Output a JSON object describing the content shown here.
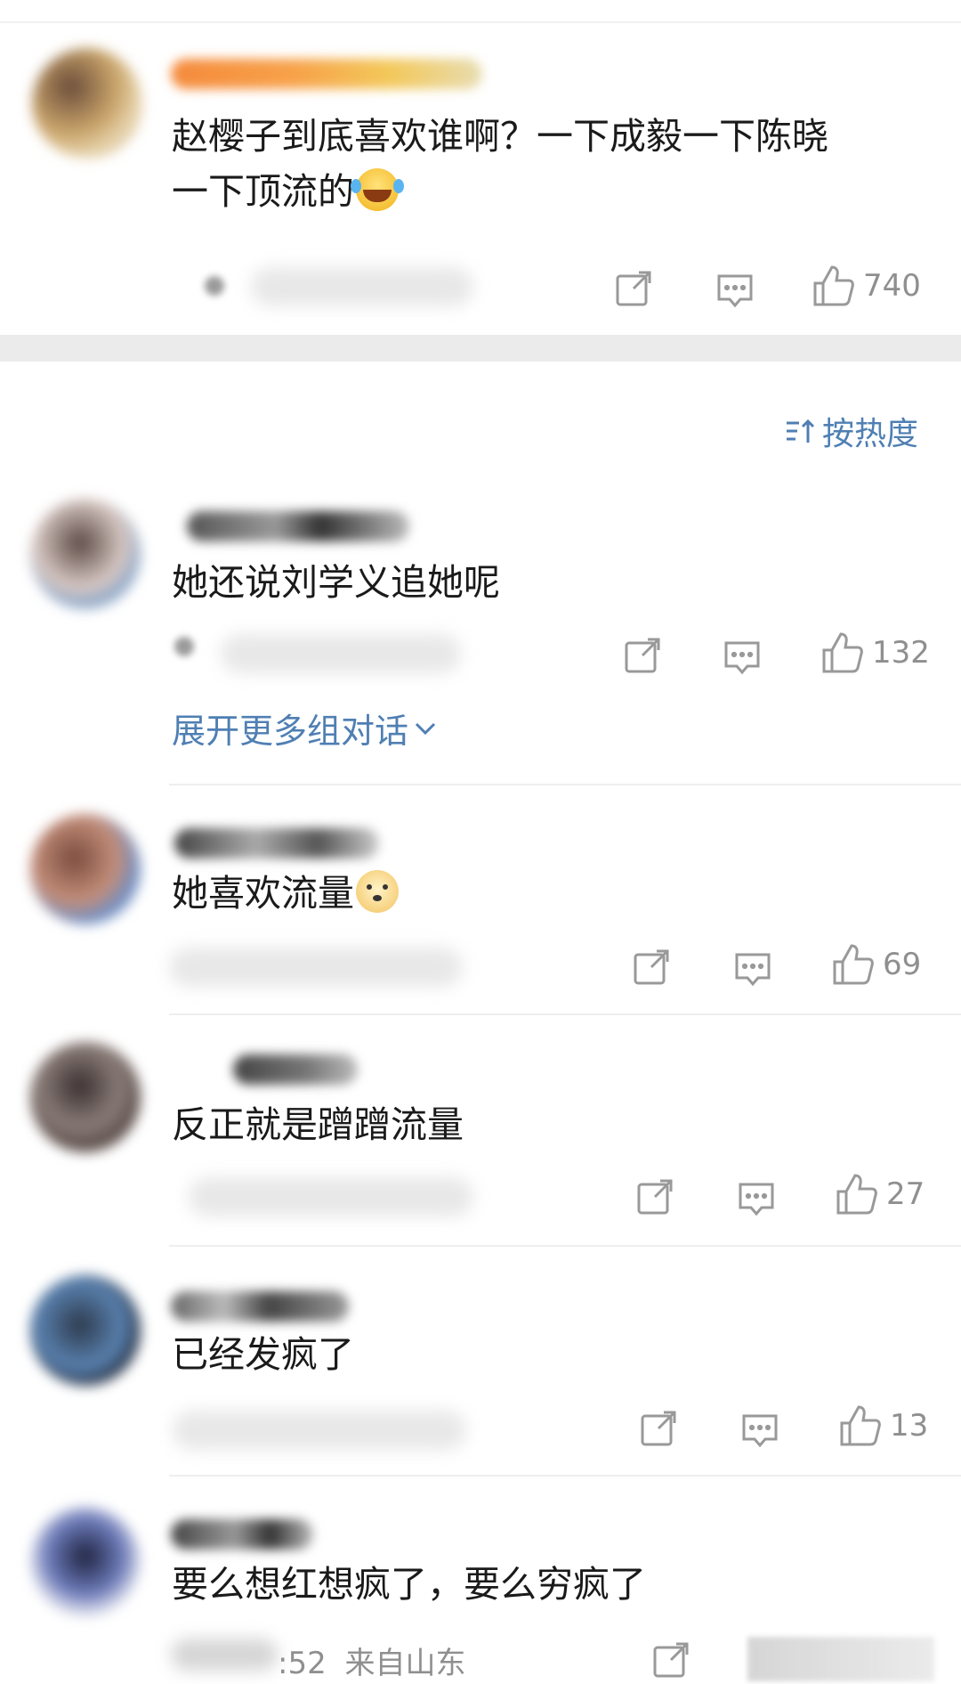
{
  "post": {
    "text_line1": "赵樱子到底喜欢谁啊？一下成毅一下陈晓",
    "text_line2": "一下顶流的",
    "like_count": "740"
  },
  "sort": {
    "label": "按热度"
  },
  "comments": [
    {
      "text": "她还说刘学义追她呢",
      "like_count": "132",
      "expand_label": "展开更多组对话"
    },
    {
      "text": "她喜欢流量",
      "like_count": "69"
    },
    {
      "text": "反正就是蹭蹭流量",
      "like_count": "27"
    },
    {
      "text": "已经发疯了",
      "like_count": "13"
    },
    {
      "text": "要么想红想疯了，要么穷疯了",
      "meta_time": ":52",
      "meta_location": "来自山东"
    }
  ],
  "icons": {
    "repost": "repost-icon",
    "comment": "comment-icon",
    "like": "thumbs-up-icon",
    "sort": "sort-icon",
    "expand": "chevron-down-icon"
  },
  "colors": {
    "link": "#4f7fb3",
    "muted": "#8f8f8f",
    "band": "#ebebeb"
  }
}
